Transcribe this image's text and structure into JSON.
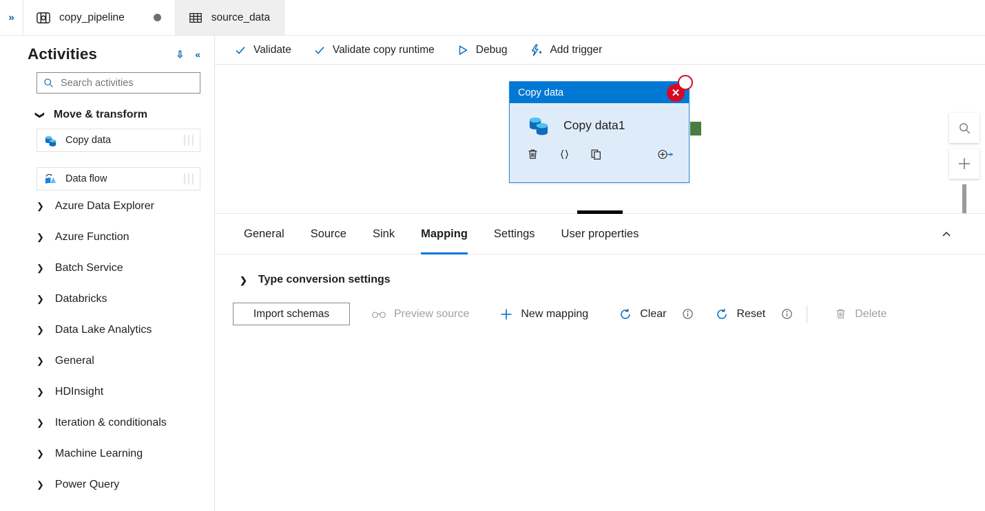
{
  "window": {
    "rail_expand_icon": "chevron-double-right-icon"
  },
  "tabs": [
    {
      "label": "copy_pipeline",
      "icon": "pipeline-icon",
      "active": true,
      "dirty_dot": true
    },
    {
      "label": "source_data",
      "icon": "dataset-table-icon",
      "active": false,
      "dirty_dot": false
    }
  ],
  "activities_panel": {
    "title": "Activities",
    "collapse_all_icon": "chevron-double-down-icon",
    "collapse_panel_icon": "chevron-double-left-icon",
    "search": {
      "placeholder": "Search activities",
      "value": "",
      "icon": "search-icon"
    },
    "group": {
      "label": "Move & transform",
      "expanded": true,
      "items": [
        {
          "label": "Copy data",
          "icon": "copy-data-icon"
        },
        {
          "label": "Data flow",
          "icon": "data-flow-icon"
        }
      ]
    },
    "categories": [
      {
        "label": "Azure Data Explorer"
      },
      {
        "label": "Azure Function"
      },
      {
        "label": "Batch Service"
      },
      {
        "label": "Databricks"
      },
      {
        "label": "Data Lake Analytics"
      },
      {
        "label": "General"
      },
      {
        "label": "HDInsight"
      },
      {
        "label": "Iteration & conditionals"
      },
      {
        "label": "Machine Learning"
      },
      {
        "label": "Power Query"
      }
    ]
  },
  "toolbar": {
    "validate_label": "Validate",
    "validate_copy_runtime_label": "Validate copy runtime",
    "debug_label": "Debug",
    "add_trigger_label": "Add trigger"
  },
  "canvas": {
    "node": {
      "header_label": "Copy data",
      "name": "Copy data1",
      "close_icon": "close-icon",
      "actions": [
        {
          "icon": "trash-icon",
          "glyph": "delete"
        },
        {
          "icon": "code-braces-icon",
          "glyph": "{}"
        },
        {
          "icon": "copy-icon",
          "glyph": "duplicate"
        },
        {
          "icon": "add-output-icon",
          "glyph": "add-output"
        }
      ]
    },
    "zoom_controls": {
      "fit_icon": "zoom-to-fit-icon",
      "zoom_in_icon": "plus-icon"
    }
  },
  "properties": {
    "tabs": [
      {
        "label": "General",
        "selected": false
      },
      {
        "label": "Source",
        "selected": false
      },
      {
        "label": "Sink",
        "selected": false
      },
      {
        "label": "Mapping",
        "selected": true
      },
      {
        "label": "Settings",
        "selected": false
      },
      {
        "label": "User properties",
        "selected": false
      }
    ],
    "collapse_icon": "chevron-up-icon",
    "type_conversion_settings": {
      "label": "Type conversion settings",
      "expanded": false
    },
    "commands": {
      "import_schemas": "Import schemas",
      "preview_source": "Preview source",
      "new_mapping": "New mapping",
      "clear": "Clear",
      "reset": "Reset",
      "delete": "Delete"
    }
  },
  "colors": {
    "accent": "#0078d4",
    "link": "#0067b8",
    "node_header": "#0078d4",
    "node_body": "#deecf9",
    "close_red": "#d60a25",
    "connector_green": "#4a7c3f",
    "disabled_text": "#a19f9d"
  }
}
